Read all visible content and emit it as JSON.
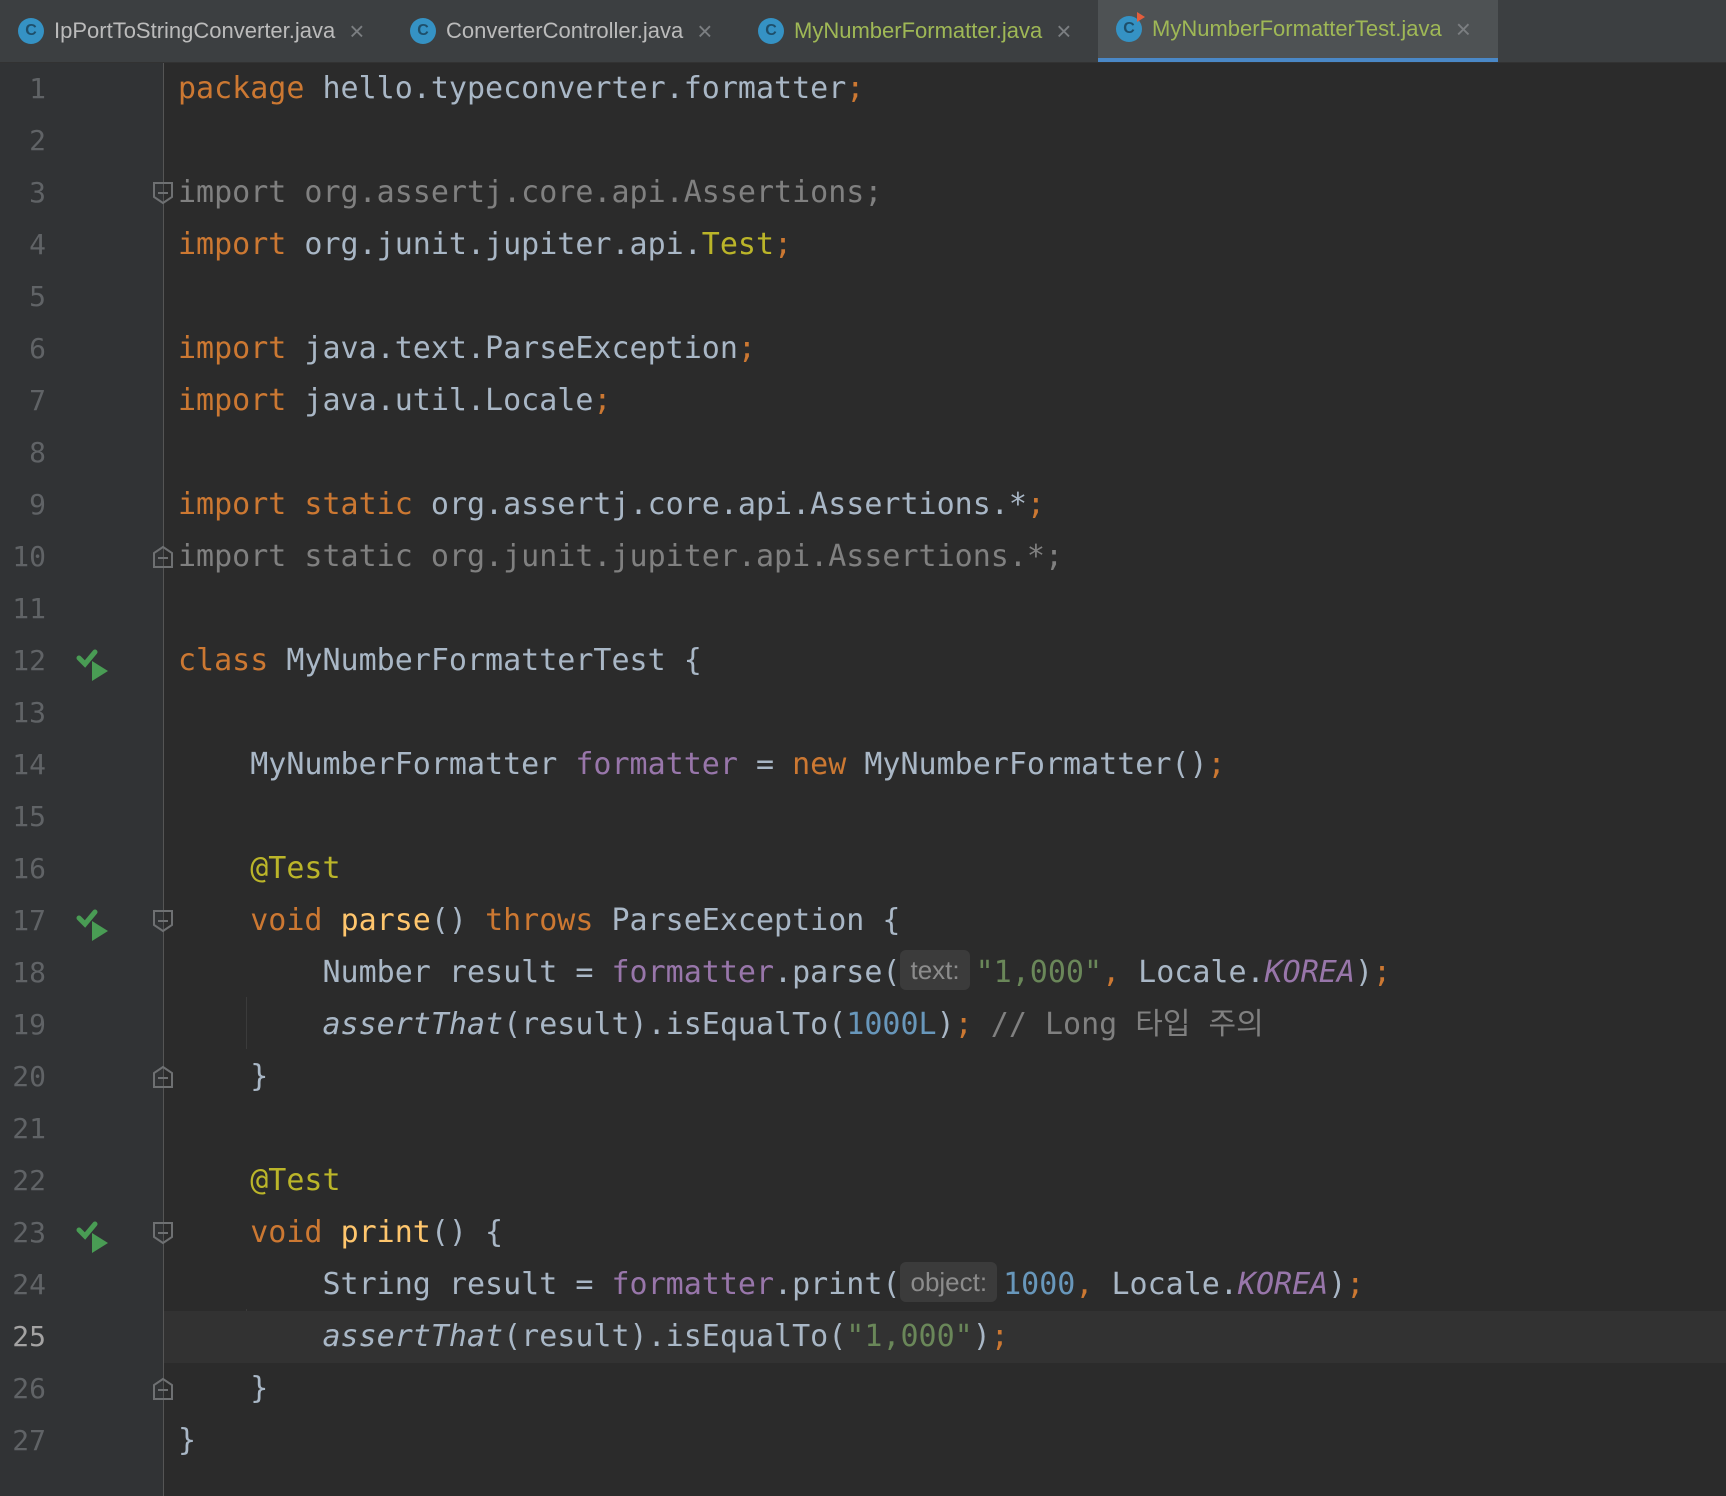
{
  "tabs": [
    {
      "label": "IpPortToStringConverter.java",
      "icon_letter": "C",
      "modified": false,
      "active": false
    },
    {
      "label": "ConverterController.java",
      "icon_letter": "C",
      "modified": false,
      "active": false
    },
    {
      "label": "MyNumberFormatter.java",
      "icon_letter": "C",
      "modified": true,
      "active": false
    },
    {
      "label": "MyNumberFormatterTest.java",
      "icon_letter": "C",
      "modified": true,
      "active": true
    }
  ],
  "editor": {
    "current_line": "25",
    "hint_text": "text:",
    "hint_object": "object:",
    "lines": [
      {
        "n": "1"
      },
      {
        "n": "2"
      },
      {
        "n": "3"
      },
      {
        "n": "4"
      },
      {
        "n": "5"
      },
      {
        "n": "6"
      },
      {
        "n": "7"
      },
      {
        "n": "8"
      },
      {
        "n": "9"
      },
      {
        "n": "10"
      },
      {
        "n": "11"
      },
      {
        "n": "12"
      },
      {
        "n": "13"
      },
      {
        "n": "14"
      },
      {
        "n": "15"
      },
      {
        "n": "16"
      },
      {
        "n": "17"
      },
      {
        "n": "18"
      },
      {
        "n": "19"
      },
      {
        "n": "20"
      },
      {
        "n": "21"
      },
      {
        "n": "22"
      },
      {
        "n": "23"
      },
      {
        "n": "24"
      },
      {
        "n": "25"
      },
      {
        "n": "26"
      },
      {
        "n": "27"
      }
    ],
    "code": {
      "l1": {
        "kw": "package",
        "rest": " hello.typeconverter.formatter",
        "semi": ";"
      },
      "l3": "import org.assertj.core.api.Assertions;",
      "l4": {
        "kw": "import",
        "pkg": " org.junit.jupiter.api.",
        "cls": "Test",
        "semi": ";"
      },
      "l6": {
        "kw": "import",
        "rest": " java.text.ParseException",
        "semi": ";"
      },
      "l7": {
        "kw": "import",
        "rest": " java.util.Locale",
        "semi": ";"
      },
      "l9": {
        "kw": "import",
        "kw2": " static",
        "rest": " org.assertj.core.api.Assertions.*",
        "semi": ";"
      },
      "l10": "import static org.junit.jupiter.api.Assertions.*;",
      "l12": {
        "kw": "class",
        "rest": " MyNumberFormatterTest {"
      },
      "l14": {
        "type": "    MyNumberFormatter ",
        "field": "formatter",
        "eq": " = ",
        "kw": "new",
        "rest": " MyNumberFormatter()",
        "semi": ";"
      },
      "l16": "    @Test",
      "l17": {
        "kw": "    void ",
        "method": "parse",
        "mid": "() ",
        "kw2": "throws",
        "rest": " ParseException {"
      },
      "l18": {
        "a": "        Number result = ",
        "field": "formatter",
        "b": ".parse(",
        "str": "\"1,000\"",
        "comma": ",",
        "c": " Locale.",
        "konst": "KOREA",
        "d": ")",
        "semi": ";"
      },
      "l19": {
        "a": "        ",
        "stat": "assertThat",
        "b": "(result).isEqualTo(",
        "num": "1000L",
        "c": ")",
        "semi": ";",
        "cmt": " // Long 타입 주의"
      },
      "l20": "    }",
      "l22": "    @Test",
      "l23": {
        "kw": "    void ",
        "method": "print",
        "rest": "() {"
      },
      "l24": {
        "a": "        String result = ",
        "field": "formatter",
        "b": ".print(",
        "num": "1000",
        "comma": ",",
        "c": " Locale.",
        "konst": "KOREA",
        "d": ")",
        "semi": ";"
      },
      "l25": {
        "a": "        ",
        "stat": "assertThat",
        "b": "(result).isEqualTo(",
        "str": "\"1,000\"",
        "c": ")",
        "semi": ";"
      },
      "l26": "    }",
      "l27": "}"
    }
  }
}
